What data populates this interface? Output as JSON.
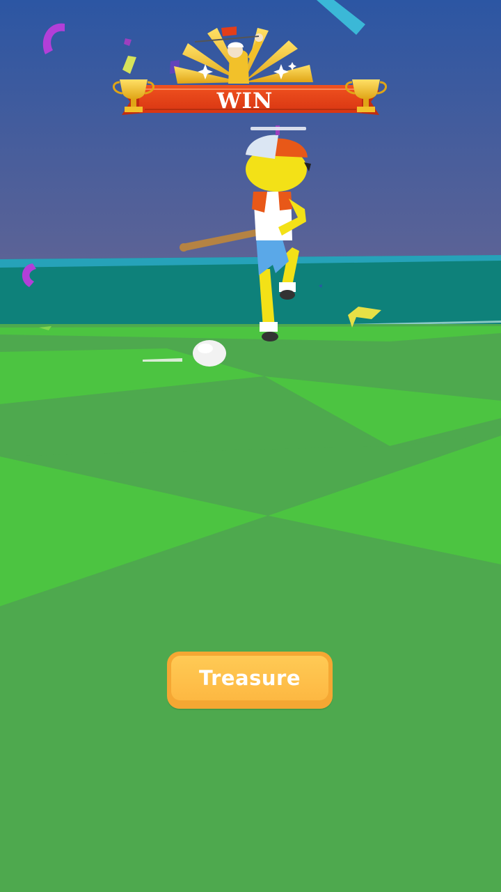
{
  "banner": {
    "result_text": "WIN"
  },
  "buttons": {
    "treasure_label": "Treasure"
  },
  "colors": {
    "sky_top": "#2c56a3",
    "sky_bottom": "#5a6397",
    "sea": "#0e817a",
    "grass_light": "#4cc441",
    "grass_dark": "#4ea94e",
    "banner_red": "#e23e1a",
    "trophy_gold": "#f2c12a",
    "button_orange": "#f5a733",
    "button_face": "#fdb842"
  }
}
